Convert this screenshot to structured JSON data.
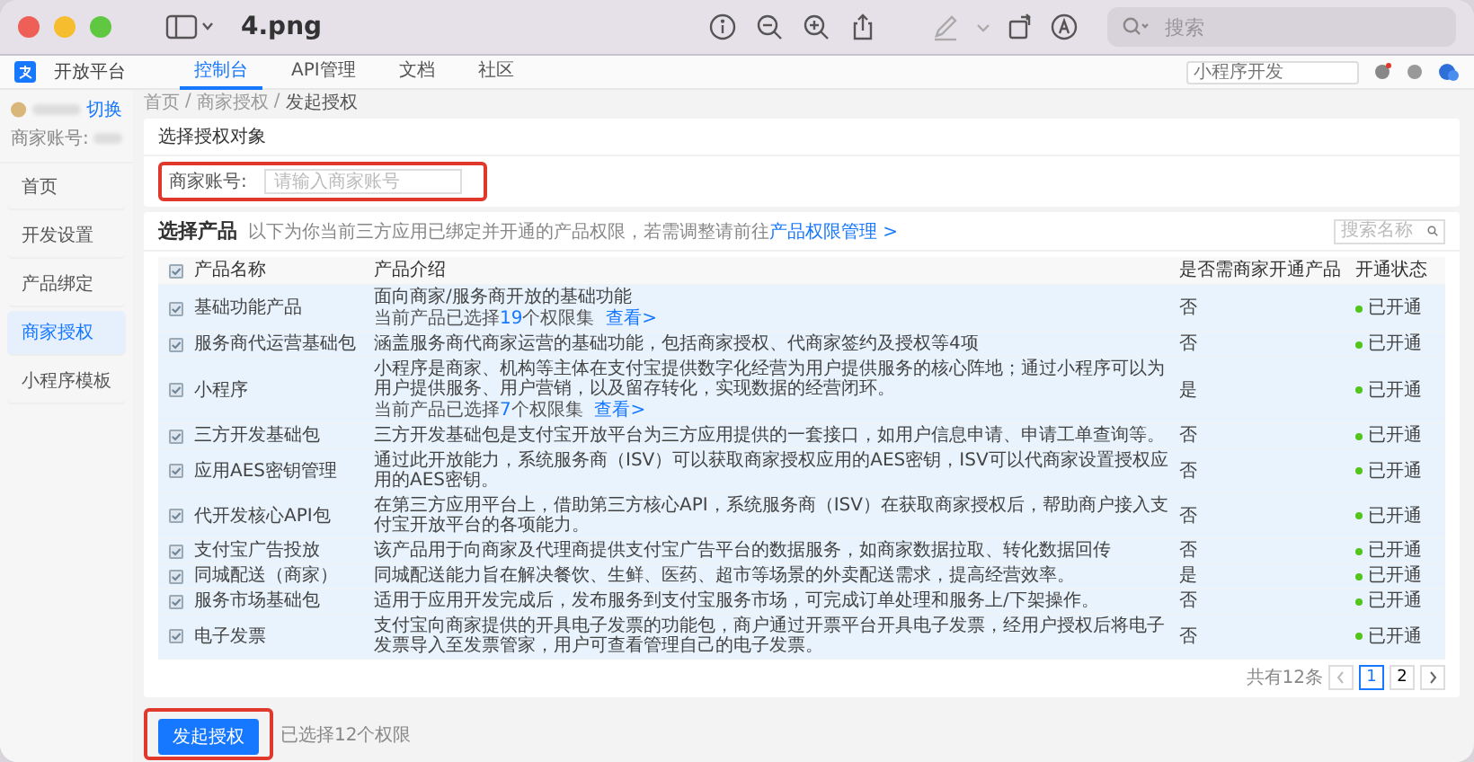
{
  "window": {
    "title": "4.png",
    "search_placeholder": "搜索"
  },
  "site": {
    "brand": "开放平台",
    "search_placeholder": "小程序开发",
    "nav": [
      {
        "label": "控制台",
        "selected": true
      },
      {
        "label": "API管理",
        "selected": false
      },
      {
        "label": "文档",
        "selected": false
      },
      {
        "label": "社区",
        "selected": false
      }
    ]
  },
  "sidebar": {
    "switch_link": "切换",
    "account_label": "商家账号:",
    "items": [
      {
        "label": "首页",
        "selected": false
      },
      {
        "label": "开发设置",
        "selected": false
      },
      {
        "label": "产品绑定",
        "selected": false
      },
      {
        "label": "商家授权",
        "selected": true
      },
      {
        "label": "小程序模板",
        "selected": false
      }
    ]
  },
  "breadcrumb": [
    "首页",
    "商家授权",
    "发起授权"
  ],
  "breadcrumb_separator": "/",
  "target_card": {
    "title": "选择授权对象",
    "field_label": "商家账号:",
    "placeholder": "请输入商家账号"
  },
  "product_card": {
    "title": "选择产品",
    "note": "以下为你当前三方应用已绑定并开通的产品权限，若需调整请前往",
    "link": "产品权限管理 >",
    "search_placeholder": "搜索名称"
  },
  "table": {
    "header_checked": true,
    "columns": [
      "产品名称",
      "产品介绍",
      "是否需商家开通产品",
      "开通状态"
    ],
    "rows": [
      {
        "name": "基础功能产品",
        "description": "面向商家/服务商开放的基础功能",
        "sub_note": {
          "text": "当前产品已选择",
          "count": "19",
          "unit": "个权限集",
          "link": "查看>"
        },
        "checked": true,
        "selected": true,
        "needs_merchant": "否",
        "status": "已开通"
      },
      {
        "name": "服务商代运营基础包",
        "description": "涵盖服务商代商家运营的基础功能，包括商家授权、代商家签约及授权等4项",
        "checked": true,
        "selected": true,
        "needs_merchant": "否",
        "status": "已开通"
      },
      {
        "name": "小程序",
        "description": "小程序是商家、机构等主体在支付宝提供数字化经营为用户提供服务的核心阵地；通过小程序可以为用户提供服务、用户营销，以及留存转化，实现数据的经营闭环。",
        "sub_note": {
          "text": "当前产品已选择",
          "count": "7",
          "unit": "个权限集",
          "link": "查看>"
        },
        "checked": true,
        "selected": true,
        "needs_merchant": "是",
        "status": "已开通"
      },
      {
        "name": "三方开发基础包",
        "description": "三方开发基础包是支付宝开放平台为三方应用提供的一套接口，如用户信息申请、申请工单查询等。",
        "checked": true,
        "selected": true,
        "needs_merchant": "否",
        "status": "已开通"
      },
      {
        "name": "应用AES密钥管理",
        "description": "通过此开放能力，系统服务商（ISV）可以获取商家授权应用的AES密钥，ISV可以代商家设置授权应用的AES密钥。",
        "checked": true,
        "selected": true,
        "needs_merchant": "否",
        "status": "已开通"
      },
      {
        "name": "代开发核心API包",
        "description": "在第三方应用平台上，借助第三方核心API，系统服务商（ISV）在获取商家授权后，帮助商户接入支付宝开放平台的各项能力。",
        "checked": true,
        "selected": true,
        "needs_merchant": "否",
        "status": "已开通"
      },
      {
        "name": "支付宝广告投放",
        "description": "该产品用于向商家及代理商提供支付宝广告平台的数据服务，如商家数据拉取、转化数据回传",
        "checked": true,
        "selected": true,
        "needs_merchant": "否",
        "status": "已开通"
      },
      {
        "name": "同城配送（商家）",
        "description": "同城配送能力旨在解决餐饮、生鲜、医药、超市等场景的外卖配送需求，提高经营效率。",
        "checked": true,
        "selected": true,
        "needs_merchant": "是",
        "status": "已开通"
      },
      {
        "name": "服务市场基础包",
        "description": "适用于应用开发完成后，发布服务到支付宝服务市场，可完成订单处理和服务上/下架操作。",
        "checked": true,
        "selected": true,
        "needs_merchant": "否",
        "status": "已开通"
      },
      {
        "name": "电子发票",
        "description": "支付宝向商家提供的开具电子发票的功能包，商户通过开票平台开具电子发票，经用户授权后将电子发票导入至发票管家，用户可查看管理自己的电子发票。",
        "checked": true,
        "selected": true,
        "needs_merchant": "否",
        "status": "已开通"
      }
    ]
  },
  "pagination": {
    "total": "共有12条",
    "pages": [
      {
        "label": "1",
        "selected": true
      },
      {
        "label": "2",
        "selected": false
      }
    ]
  },
  "footer": {
    "button": "发起授权",
    "note": "已选择12个权限"
  }
}
